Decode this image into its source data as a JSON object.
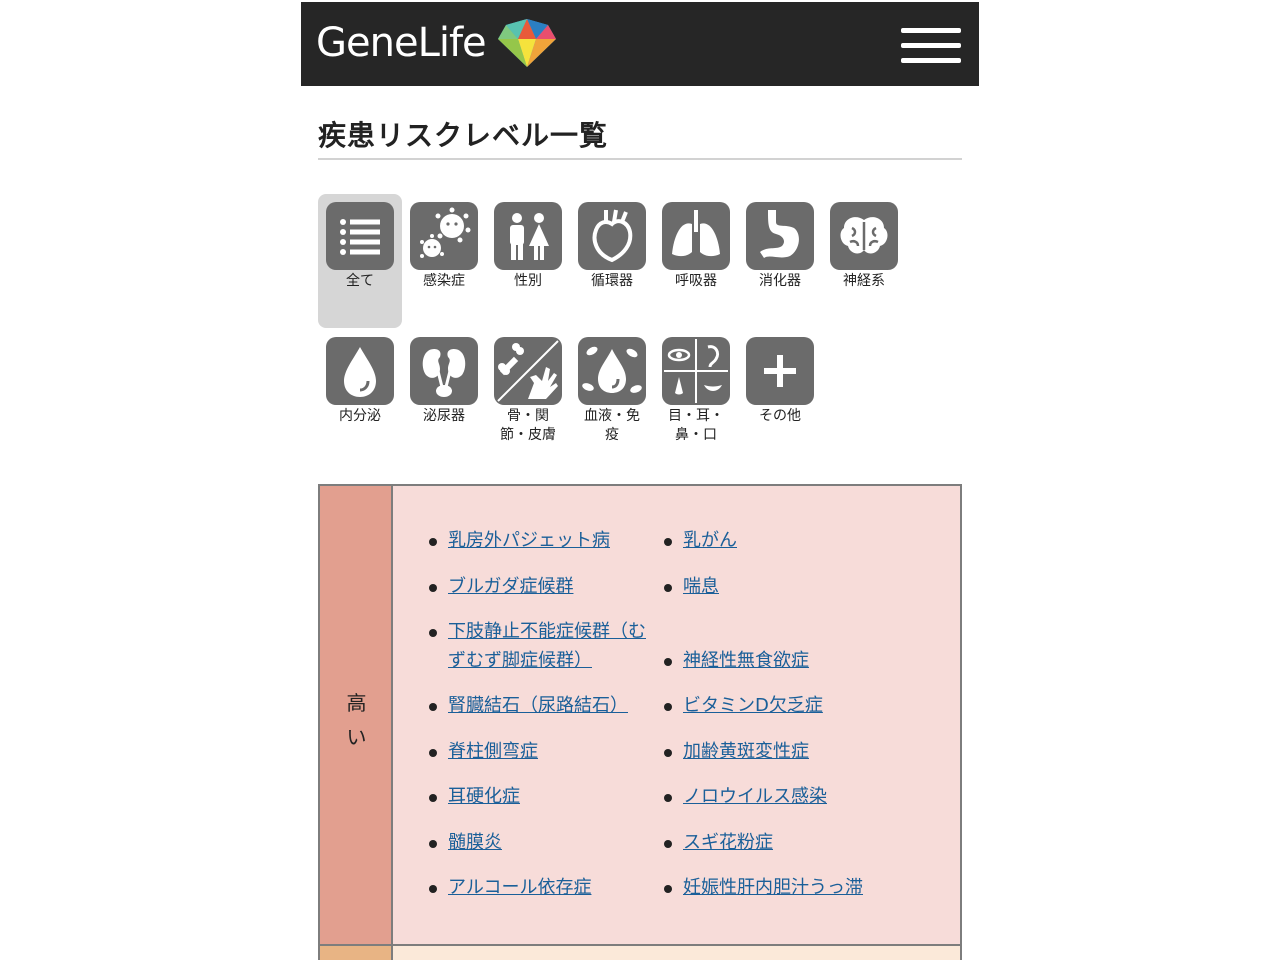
{
  "header": {
    "brand": "GeneLife"
  },
  "page_title": "疾患リスクレベル一覧",
  "categories": [
    {
      "label": "全て",
      "icon": "list-icon",
      "active": true
    },
    {
      "label": "感染症",
      "icon": "virus-icon"
    },
    {
      "label": "性別",
      "icon": "gender-icon"
    },
    {
      "label": "循環器",
      "icon": "heart-icon"
    },
    {
      "label": "呼吸器",
      "icon": "lungs-icon"
    },
    {
      "label": "消化器",
      "icon": "stomach-icon"
    },
    {
      "label": "神経系",
      "icon": "brain-icon"
    },
    {
      "label": "内分泌",
      "icon": "drop-icon"
    },
    {
      "label": "泌尿器",
      "icon": "kidney-icon"
    },
    {
      "label": "骨・関\n節・皮膚",
      "icon": "bone-hand-icon"
    },
    {
      "label": "血液・免\n疫",
      "icon": "blood-cell-icon"
    },
    {
      "label": "目・耳・\n鼻・口",
      "icon": "eye-ear-nose-mouth-icon"
    },
    {
      "label": "その他",
      "icon": "plus-icon"
    }
  ],
  "risk_table": {
    "level_label": "高\nい",
    "level_color": "#e29f8f",
    "body_color": "#f7dcd9",
    "left_column": [
      "乳房外パジェット病",
      "ブルガダ症候群",
      "下肢静止不能症候群（む\nずむず脚症候群）",
      "腎臓結石（尿路結石）",
      "脊柱側弯症",
      "耳硬化症",
      "髄膜炎",
      "アルコール依存症"
    ],
    "right_column": [
      "乳がん",
      "喘息",
      "神経性無食欲症",
      "ビタミンD欠乏症",
      "加齢黄斑変性症",
      "ノロウイルス感染",
      "スギ花粉症",
      "妊娠性肝内胆汁うっ滞"
    ],
    "link_color": "#1a5f99"
  }
}
